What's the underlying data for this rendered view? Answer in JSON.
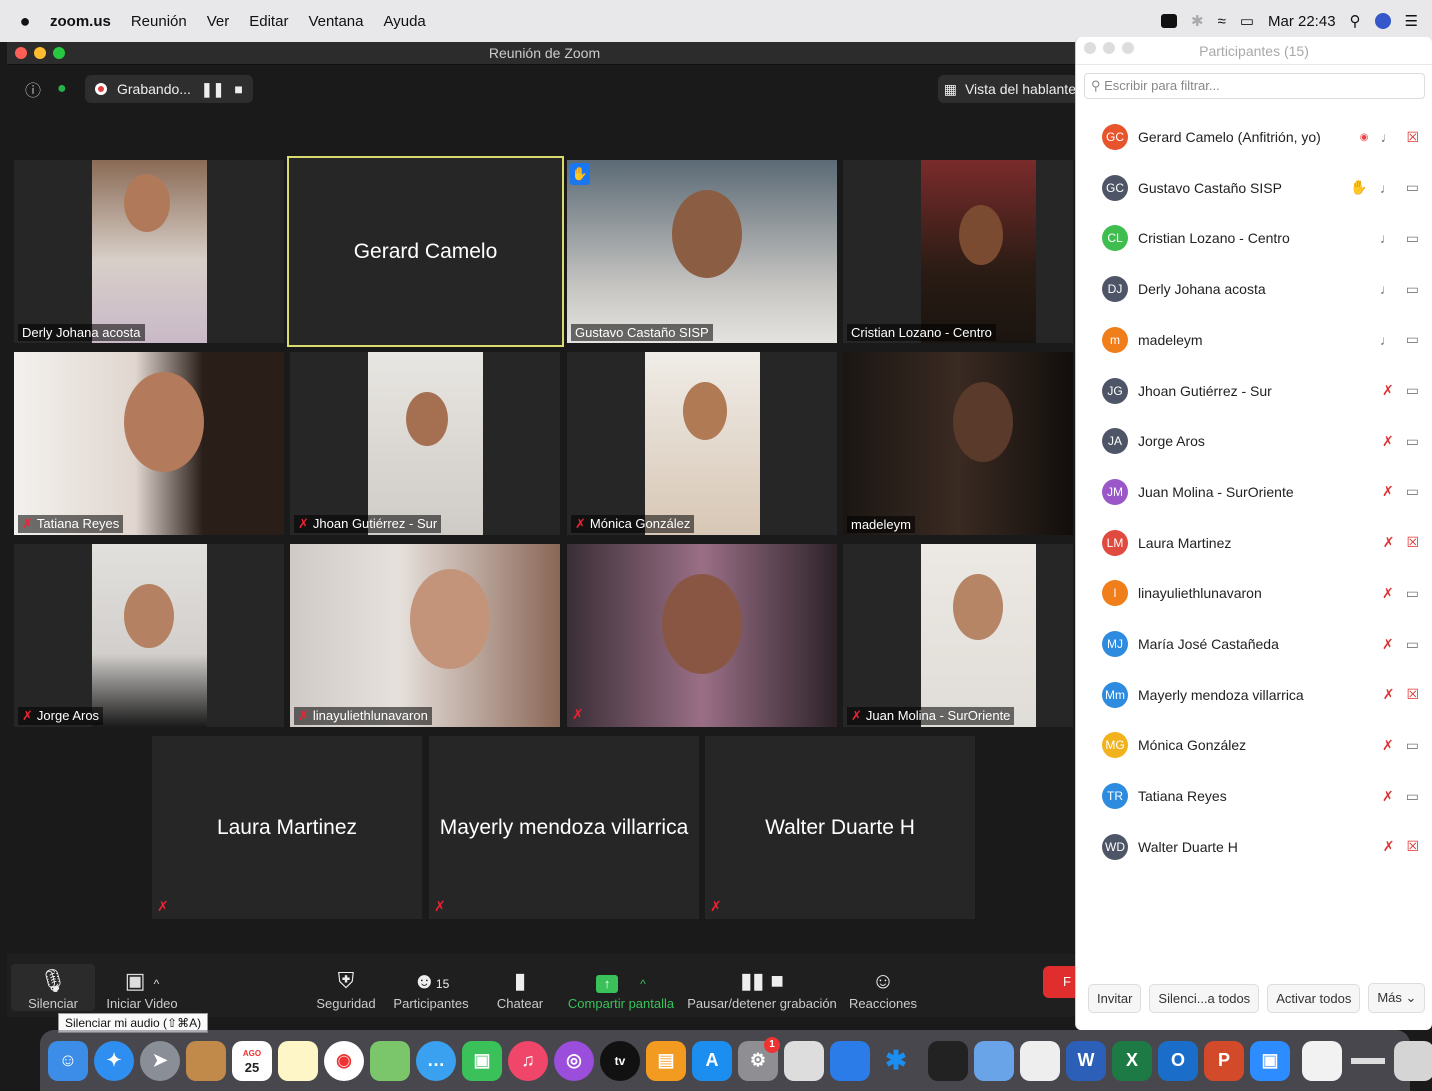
{
  "menubar": {
    "apple": "",
    "app": "zoom.us",
    "items": [
      "Reunión",
      "Ver",
      "Editar",
      "Ventana",
      "Ayuda"
    ],
    "clock": "Mar 22:43"
  },
  "window": {
    "title": "Reunión de Zoom",
    "recording_label": "Grabando...",
    "speaker_view_label": "Vista del hablante"
  },
  "tiles": [
    {
      "name": "Derly Johana acosta",
      "muted": false
    },
    {
      "name": "Gerard Camelo",
      "muted": false,
      "no_video": true
    },
    {
      "name": "Gustavo Castaño SISP",
      "muted": false,
      "hand": true
    },
    {
      "name": "Cristian Lozano - Centro",
      "muted": false
    },
    {
      "name": "Tatiana Reyes",
      "muted": true
    },
    {
      "name": "Jhoan Gutiérrez - Sur",
      "muted": true
    },
    {
      "name": "Mónica González",
      "muted": true
    },
    {
      "name": "madeleym",
      "muted": false
    },
    {
      "name": "Jorge Aros",
      "muted": true
    },
    {
      "name": "linayuliethlunavaron",
      "muted": true
    },
    {
      "name": "",
      "muted": true
    },
    {
      "name": "Juan Molina - SurOriente",
      "muted": true
    },
    {
      "name": "Laura Martinez",
      "muted": true,
      "no_video": true
    },
    {
      "name": "Mayerly mendoza villarrica",
      "muted": true,
      "no_video": true
    },
    {
      "name": "Walter Duarte H",
      "muted": true,
      "no_video": true
    }
  ],
  "toolbar": {
    "mute": "Silenciar",
    "video": "Iniciar Video",
    "security": "Seguridad",
    "participants": "Participantes",
    "participants_count": "15",
    "chat": "Chatear",
    "share": "Compartir pantalla",
    "record": "Pausar/detener grabación",
    "reactions": "Reacciones",
    "tooltip": "Silenciar mi audio (⇧⌘A)",
    "end_letter": "F"
  },
  "participants_panel": {
    "title": "Participantes (15)",
    "filter_placeholder": "Escribir para filtrar...",
    "list": [
      {
        "initials": "GC",
        "name": "Gerard Camelo (Anfitrión, yo)",
        "color": "#e8542b",
        "mic_muted": false,
        "cam_off": true,
        "recording": true
      },
      {
        "initials": "GC",
        "name": "Gustavo Castaño SISP",
        "color": "#4e5566",
        "mic_muted": false,
        "cam_off": false,
        "hand": true
      },
      {
        "initials": "CL",
        "name": "Cristian Lozano - Centro",
        "color": "#3fbe4f",
        "mic_muted": false,
        "cam_off": false
      },
      {
        "initials": "DJ",
        "name": "Derly Johana acosta",
        "color": "#4e5566",
        "mic_muted": false,
        "cam_off": false
      },
      {
        "initials": "m",
        "name": "madeleym",
        "color": "#f07e1b",
        "mic_muted": false,
        "cam_off": false
      },
      {
        "initials": "JG",
        "name": "Jhoan Gutiérrez - Sur",
        "color": "#4e5566",
        "mic_muted": true,
        "cam_off": false
      },
      {
        "initials": "JA",
        "name": "Jorge Aros",
        "color": "#4e5566",
        "mic_muted": true,
        "cam_off": false
      },
      {
        "initials": "JM",
        "name": "Juan Molina - SurOriente",
        "color": "#9a57c8",
        "mic_muted": true,
        "cam_off": false
      },
      {
        "initials": "LM",
        "name": "Laura Martinez",
        "color": "#e04a3f",
        "mic_muted": true,
        "cam_off": true
      },
      {
        "initials": "l",
        "name": "linayuliethlunavaron",
        "color": "#f07e1b",
        "mic_muted": true,
        "cam_off": false
      },
      {
        "initials": "MJ",
        "name": "María José Castañeda",
        "color": "#2d8ce0",
        "mic_muted": true,
        "cam_off": false
      },
      {
        "initials": "Mm",
        "name": "Mayerly mendoza villarrica",
        "color": "#2d8ce0",
        "mic_muted": true,
        "cam_off": true
      },
      {
        "initials": "MG",
        "name": "Mónica González",
        "color": "#f2b21e",
        "mic_muted": true,
        "cam_off": false
      },
      {
        "initials": "TR",
        "name": "Tatiana Reyes",
        "color": "#2d8ce0",
        "mic_muted": true,
        "cam_off": false
      },
      {
        "initials": "WD",
        "name": "Walter Duarte H",
        "color": "#4e5566",
        "mic_muted": true,
        "cam_off": true
      }
    ],
    "footer": {
      "invite": "Invitar",
      "mute_all": "Silenci...a todos",
      "unmute_all": "Activar todos",
      "more": "Más"
    }
  },
  "dock": {
    "calendar_day": "25",
    "calendar_month": "AGO",
    "badge": "1",
    "tv_label": "tv",
    "word_letter": "W",
    "excel_letter": "X",
    "outlook_letter": "O",
    "ppt_letter": "P"
  }
}
